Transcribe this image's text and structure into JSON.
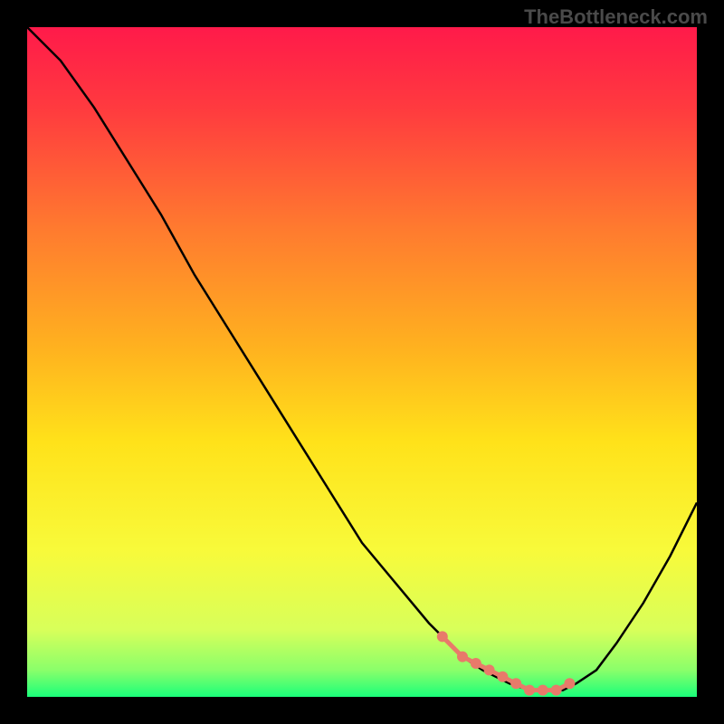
{
  "watermark": "TheBottleneck.com",
  "chart_data": {
    "type": "line",
    "title": "",
    "xlabel": "",
    "ylabel": "",
    "xlim": [
      0,
      100
    ],
    "ylim": [
      0,
      100
    ],
    "gradient_stops": [
      {
        "offset": 0,
        "color": "#ff1a4a"
      },
      {
        "offset": 12,
        "color": "#ff3a3f"
      },
      {
        "offset": 30,
        "color": "#ff7a2f"
      },
      {
        "offset": 48,
        "color": "#ffb21f"
      },
      {
        "offset": 62,
        "color": "#ffe21a"
      },
      {
        "offset": 78,
        "color": "#f8fa3a"
      },
      {
        "offset": 90,
        "color": "#d8ff5a"
      },
      {
        "offset": 96,
        "color": "#8aff6a"
      },
      {
        "offset": 100,
        "color": "#1aff7a"
      }
    ],
    "series": [
      {
        "name": "curve",
        "x": [
          0,
          5,
          10,
          15,
          20,
          25,
          30,
          35,
          40,
          45,
          50,
          55,
          60,
          62,
          65,
          68,
          72,
          75,
          78,
          80,
          82,
          85,
          88,
          92,
          96,
          100
        ],
        "y": [
          100,
          95,
          88,
          80,
          72,
          63,
          55,
          47,
          39,
          31,
          23,
          17,
          11,
          9,
          6,
          4,
          2,
          1,
          1,
          1,
          2,
          4,
          8,
          14,
          21,
          29
        ]
      }
    ],
    "markers": {
      "name": "highlight",
      "x": [
        62,
        65,
        67,
        69,
        71,
        73,
        75,
        77,
        79,
        81
      ],
      "y": [
        9,
        6,
        5,
        4,
        3,
        2,
        1,
        1,
        1,
        2
      ]
    }
  }
}
